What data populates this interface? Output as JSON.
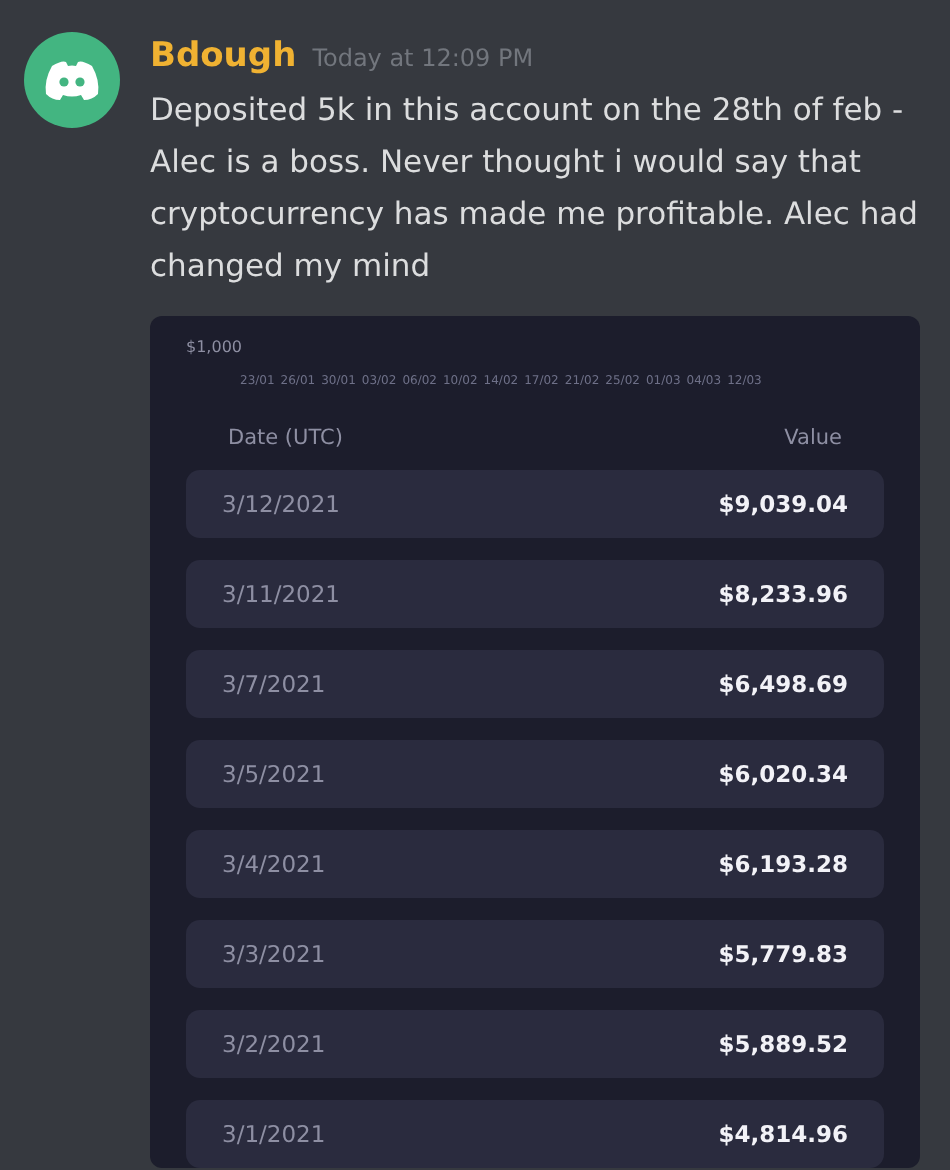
{
  "message": {
    "author": "Bdough",
    "timestamp": "Today at 12:09 PM",
    "text": "Deposited 5k in this account on the 28th of feb - Alec is a boss. Never thought i would say that cryptocurrency has made me profitable. Alec had changed my mind"
  },
  "screenshot": {
    "y_axis_label": "$1,000",
    "x_axis_labels": [
      "23/01",
      "26/01",
      "30/01",
      "03/02",
      "06/02",
      "10/02",
      "14/02",
      "17/02",
      "21/02",
      "25/02",
      "01/03",
      "04/03",
      "12/03"
    ],
    "table": {
      "columns": [
        "Date (UTC)",
        "Value"
      ],
      "rows": [
        {
          "date": "3/12/2021",
          "value": "$9,039.04"
        },
        {
          "date": "3/11/2021",
          "value": "$8,233.96"
        },
        {
          "date": "3/7/2021",
          "value": "$6,498.69"
        },
        {
          "date": "3/5/2021",
          "value": "$6,020.34"
        },
        {
          "date": "3/4/2021",
          "value": "$6,193.28"
        },
        {
          "date": "3/3/2021",
          "value": "$5,779.83"
        },
        {
          "date": "3/2/2021",
          "value": "$5,889.52"
        },
        {
          "date": "3/1/2021",
          "value": "$4,814.96"
        }
      ]
    }
  }
}
